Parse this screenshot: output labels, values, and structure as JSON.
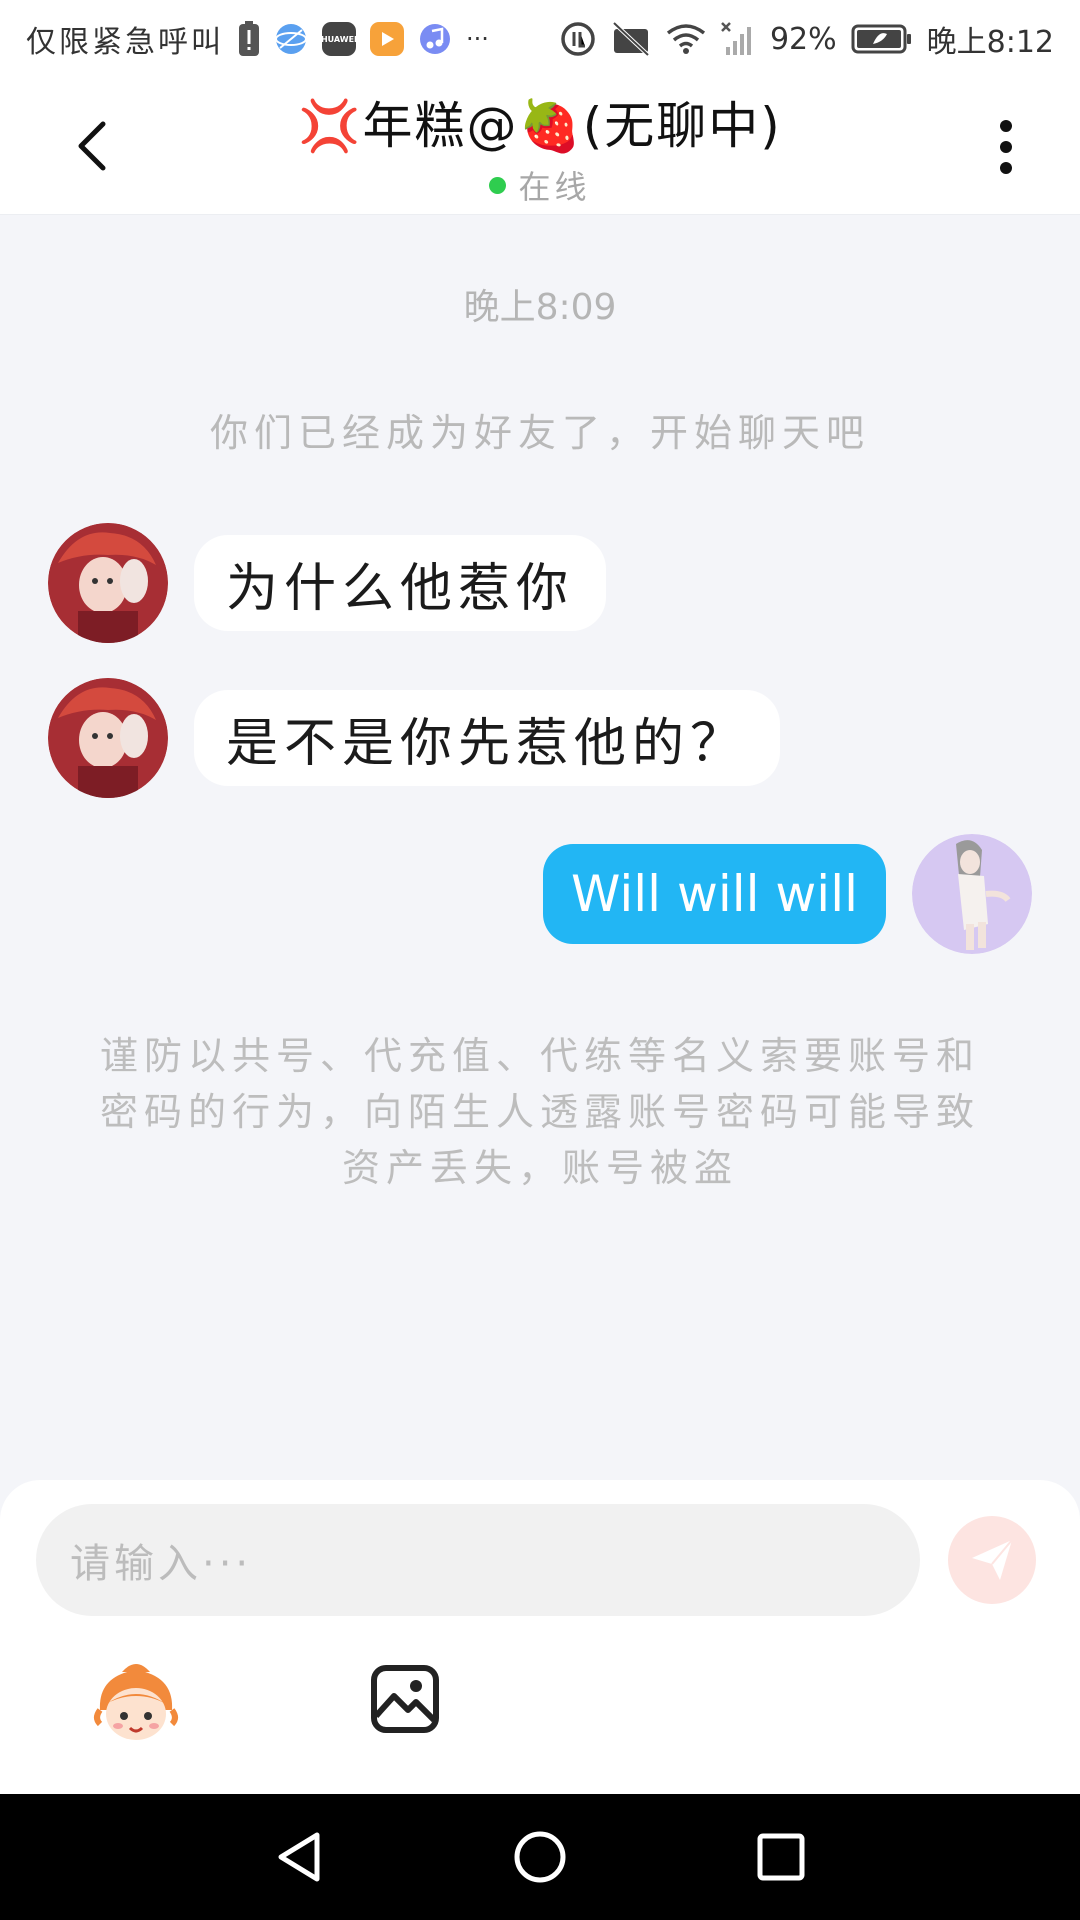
{
  "status_bar": {
    "carrier_text": "仅限紧急呼叫",
    "more_label": "···",
    "battery_percent": "92%",
    "time": "晚上8:12",
    "huawei_label": "HUAWEI"
  },
  "header": {
    "title": "💢年糕@🍓(无聊中)",
    "online_status": "在线"
  },
  "chat": {
    "timestamp": "晚上8:09",
    "system_note": "你们已经成为好友了，开始聊天吧",
    "messages": [
      {
        "direction": "incoming",
        "text": "为什么他惹你"
      },
      {
        "direction": "incoming",
        "text": "是不是你先惹他的？"
      },
      {
        "direction": "outgoing",
        "text": "Will will will"
      }
    ],
    "warning_note": "谨防以共号、代充值、代练等名义索要账号和密码的行为，向陌生人透露账号密码可能导致资产丢失，账号被盗"
  },
  "composer": {
    "placeholder": "请输入···"
  },
  "colors": {
    "outgoing_bubble": "#22b6f4",
    "online_dot": "#2fcd4f",
    "send_button": "#fde4e1"
  }
}
